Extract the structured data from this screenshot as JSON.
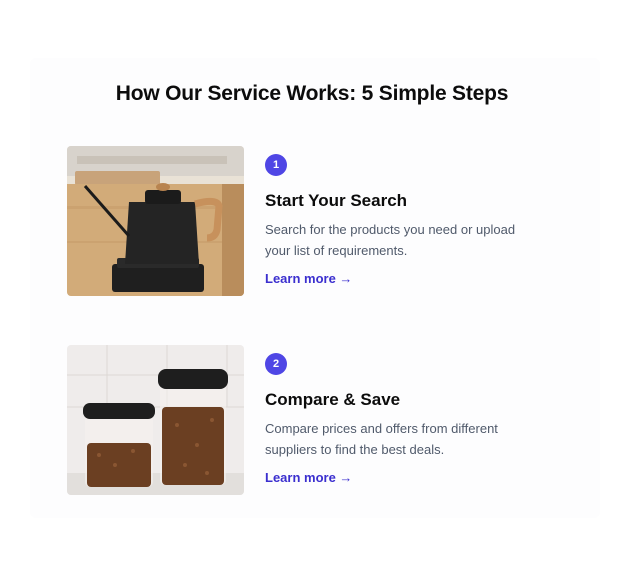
{
  "section": {
    "title": "How Our Service Works: 5 Simple Steps"
  },
  "steps": [
    {
      "number": "1",
      "title": "Start Your Search",
      "description": "Search for the products you need or upload your list of requirements.",
      "link_label": "Learn more →",
      "image": "pour-over-kettle-photo"
    },
    {
      "number": "2",
      "title": "Compare & Save",
      "description": "Compare prices and offers from different suppliers to find the best deals.",
      "link_label": "Learn more →",
      "image": "coffee-bean-jars-photo"
    }
  ],
  "colors": {
    "accent": "#4f46e5",
    "link": "#3b2fcf",
    "body_text": "#505a6b"
  }
}
